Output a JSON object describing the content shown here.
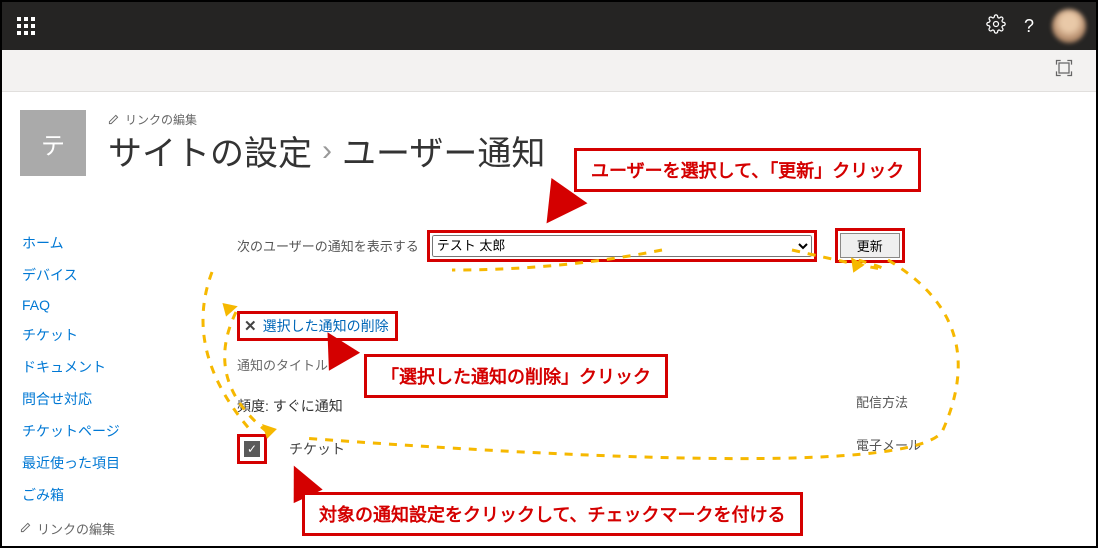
{
  "topbar": {
    "help_label": "?"
  },
  "edit_links_label": "リンクの編集",
  "tile_letter": "テ",
  "breadcrumb": {
    "root": "サイトの設定",
    "current": "ユーザー通知"
  },
  "nav": {
    "items": [
      "ホーム",
      "デバイス",
      "FAQ",
      "チケット",
      "ドキュメント",
      "問合せ対応",
      "チケットページ",
      "最近使った項目",
      "ごみ箱"
    ],
    "edit_links_label": "リンクの編集"
  },
  "user_filter": {
    "label": "次のユーザーの通知を表示する",
    "selected": "テスト 太郎",
    "update_button": "更新"
  },
  "commands": {
    "delete_selected": "選択した通知の削除"
  },
  "columns": {
    "title": "通知のタイトル",
    "delivery": "配信方法"
  },
  "frequency": {
    "label": "頻度: すぐに通知"
  },
  "rows": [
    {
      "checked": true,
      "title": "チケット",
      "delivery": "電子メール"
    }
  ],
  "callouts": {
    "c1": "ユーザーを選択して、「更新」クリック",
    "c2": "「選択した通知の削除」クリック",
    "c3": "対象の通知設定をクリックして、チェックマークを付ける"
  }
}
